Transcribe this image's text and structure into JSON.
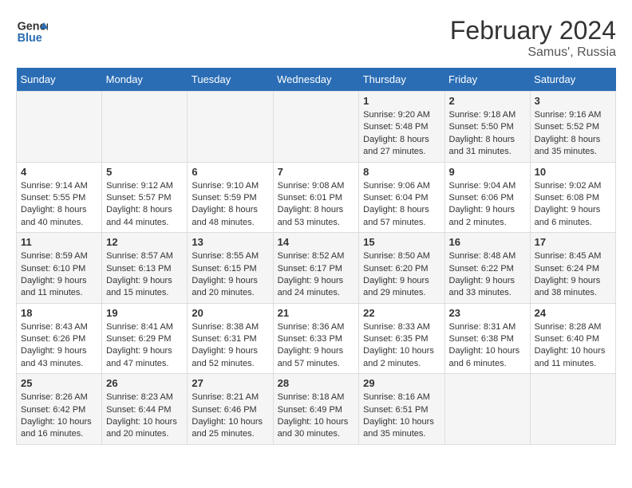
{
  "logo": {
    "line1": "General",
    "line2": "Blue"
  },
  "title": "February 2024",
  "subtitle": "Samus', Russia",
  "days_of_week": [
    "Sunday",
    "Monday",
    "Tuesday",
    "Wednesday",
    "Thursday",
    "Friday",
    "Saturday"
  ],
  "weeks": [
    [
      {
        "day": "",
        "info": ""
      },
      {
        "day": "",
        "info": ""
      },
      {
        "day": "",
        "info": ""
      },
      {
        "day": "",
        "info": ""
      },
      {
        "day": "1",
        "info": "Sunrise: 9:20 AM\nSunset: 5:48 PM\nDaylight: 8 hours and 27 minutes."
      },
      {
        "day": "2",
        "info": "Sunrise: 9:18 AM\nSunset: 5:50 PM\nDaylight: 8 hours and 31 minutes."
      },
      {
        "day": "3",
        "info": "Sunrise: 9:16 AM\nSunset: 5:52 PM\nDaylight: 8 hours and 35 minutes."
      }
    ],
    [
      {
        "day": "4",
        "info": "Sunrise: 9:14 AM\nSunset: 5:55 PM\nDaylight: 8 hours and 40 minutes."
      },
      {
        "day": "5",
        "info": "Sunrise: 9:12 AM\nSunset: 5:57 PM\nDaylight: 8 hours and 44 minutes."
      },
      {
        "day": "6",
        "info": "Sunrise: 9:10 AM\nSunset: 5:59 PM\nDaylight: 8 hours and 48 minutes."
      },
      {
        "day": "7",
        "info": "Sunrise: 9:08 AM\nSunset: 6:01 PM\nDaylight: 8 hours and 53 minutes."
      },
      {
        "day": "8",
        "info": "Sunrise: 9:06 AM\nSunset: 6:04 PM\nDaylight: 8 hours and 57 minutes."
      },
      {
        "day": "9",
        "info": "Sunrise: 9:04 AM\nSunset: 6:06 PM\nDaylight: 9 hours and 2 minutes."
      },
      {
        "day": "10",
        "info": "Sunrise: 9:02 AM\nSunset: 6:08 PM\nDaylight: 9 hours and 6 minutes."
      }
    ],
    [
      {
        "day": "11",
        "info": "Sunrise: 8:59 AM\nSunset: 6:10 PM\nDaylight: 9 hours and 11 minutes."
      },
      {
        "day": "12",
        "info": "Sunrise: 8:57 AM\nSunset: 6:13 PM\nDaylight: 9 hours and 15 minutes."
      },
      {
        "day": "13",
        "info": "Sunrise: 8:55 AM\nSunset: 6:15 PM\nDaylight: 9 hours and 20 minutes."
      },
      {
        "day": "14",
        "info": "Sunrise: 8:52 AM\nSunset: 6:17 PM\nDaylight: 9 hours and 24 minutes."
      },
      {
        "day": "15",
        "info": "Sunrise: 8:50 AM\nSunset: 6:20 PM\nDaylight: 9 hours and 29 minutes."
      },
      {
        "day": "16",
        "info": "Sunrise: 8:48 AM\nSunset: 6:22 PM\nDaylight: 9 hours and 33 minutes."
      },
      {
        "day": "17",
        "info": "Sunrise: 8:45 AM\nSunset: 6:24 PM\nDaylight: 9 hours and 38 minutes."
      }
    ],
    [
      {
        "day": "18",
        "info": "Sunrise: 8:43 AM\nSunset: 6:26 PM\nDaylight: 9 hours and 43 minutes."
      },
      {
        "day": "19",
        "info": "Sunrise: 8:41 AM\nSunset: 6:29 PM\nDaylight: 9 hours and 47 minutes."
      },
      {
        "day": "20",
        "info": "Sunrise: 8:38 AM\nSunset: 6:31 PM\nDaylight: 9 hours and 52 minutes."
      },
      {
        "day": "21",
        "info": "Sunrise: 8:36 AM\nSunset: 6:33 PM\nDaylight: 9 hours and 57 minutes."
      },
      {
        "day": "22",
        "info": "Sunrise: 8:33 AM\nSunset: 6:35 PM\nDaylight: 10 hours and 2 minutes."
      },
      {
        "day": "23",
        "info": "Sunrise: 8:31 AM\nSunset: 6:38 PM\nDaylight: 10 hours and 6 minutes."
      },
      {
        "day": "24",
        "info": "Sunrise: 8:28 AM\nSunset: 6:40 PM\nDaylight: 10 hours and 11 minutes."
      }
    ],
    [
      {
        "day": "25",
        "info": "Sunrise: 8:26 AM\nSunset: 6:42 PM\nDaylight: 10 hours and 16 minutes."
      },
      {
        "day": "26",
        "info": "Sunrise: 8:23 AM\nSunset: 6:44 PM\nDaylight: 10 hours and 20 minutes."
      },
      {
        "day": "27",
        "info": "Sunrise: 8:21 AM\nSunset: 6:46 PM\nDaylight: 10 hours and 25 minutes."
      },
      {
        "day": "28",
        "info": "Sunrise: 8:18 AM\nSunset: 6:49 PM\nDaylight: 10 hours and 30 minutes."
      },
      {
        "day": "29",
        "info": "Sunrise: 8:16 AM\nSunset: 6:51 PM\nDaylight: 10 hours and 35 minutes."
      },
      {
        "day": "",
        "info": ""
      },
      {
        "day": "",
        "info": ""
      }
    ]
  ]
}
